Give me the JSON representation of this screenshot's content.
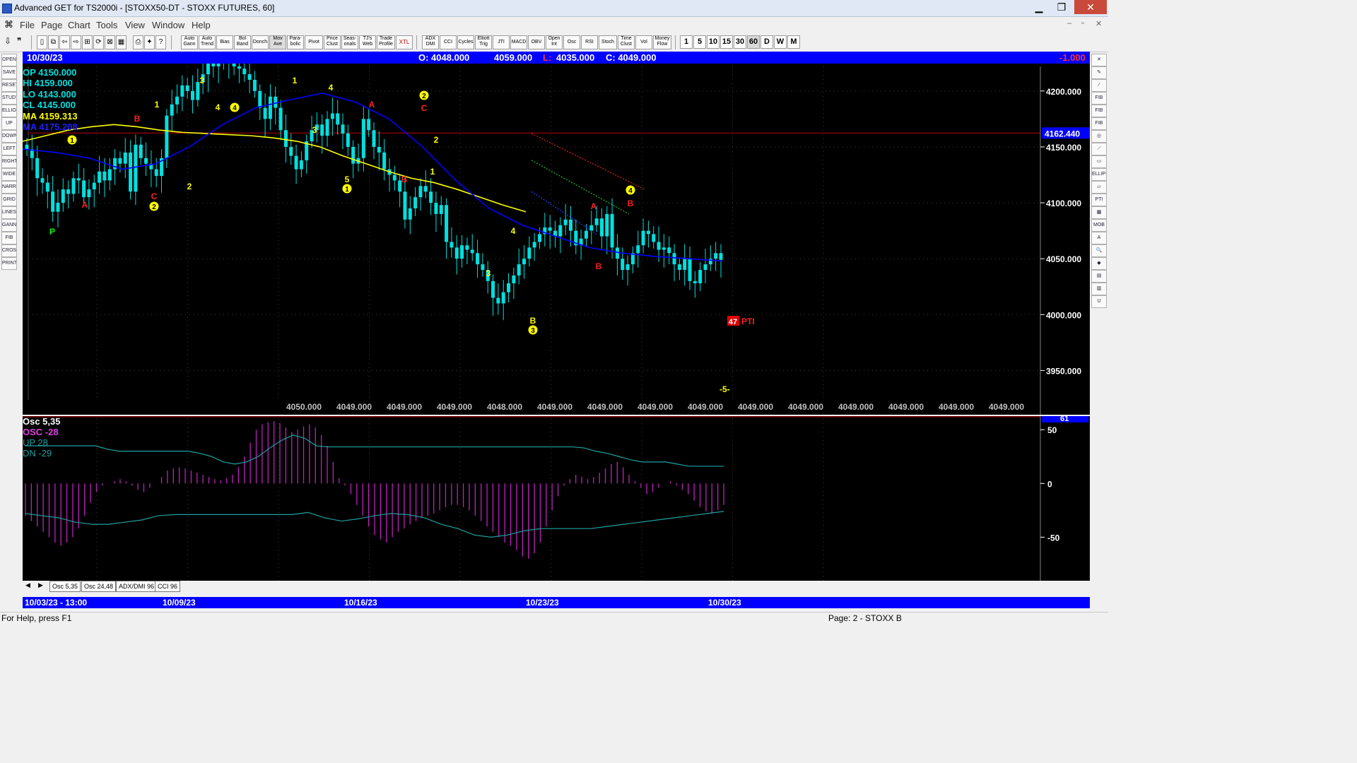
{
  "window": {
    "title": "Advanced GET for TS2000i - [STOXX50-DT - STOXX FUTURES, 60]",
    "controls": [
      "▁",
      "❐",
      "✕"
    ]
  },
  "menu": [
    "File",
    "Page",
    "Chart",
    "Tools",
    "View",
    "Window",
    "Help"
  ],
  "toolbar": {
    "studies": [
      "Auto Gann",
      "Auto Trend",
      "Bias",
      "Bol Band",
      "Donch",
      "Mov Ave",
      "Para- bolic",
      "Pivot",
      "Price Clust",
      "Seas- onals",
      "TJ's Web",
      "Trade Profile",
      "XTL",
      "ADX DMI",
      "CCI",
      "Cycles",
      "Elliott Trig",
      "JTI",
      "MACD",
      "OBV",
      "Open Int",
      "Osc",
      "RSI",
      "Stoch",
      "Time Clust",
      "Vol",
      "Money Flow"
    ],
    "timeframes": [
      "1",
      "5",
      "10",
      "15",
      "30",
      "60",
      "D",
      "W",
      "M"
    ],
    "active_timeframe": "60"
  },
  "infobar": {
    "date": "10/30/23",
    "open": "O: 4048.000",
    "high": "4059.000",
    "low_label": "L:",
    "low": "4035.000",
    "close": "C: 4049.000",
    "change": "-1.000"
  },
  "legend": {
    "op": "OP  4150.000",
    "hi": "HI   4159.000",
    "lo": "LO  4143.000",
    "cl": "CL  4145.000",
    "ma1": "MA  4159.313",
    "ma2": "MA  4175.208"
  },
  "price_axis": {
    "ticks": [
      "4200.000",
      "4150.000",
      "4100.000",
      "4050.000",
      "4000.000",
      "3950.000"
    ],
    "ylim": [
      3925,
      4222
    ],
    "current_price": "4162.440",
    "current_price_value": 4162.44
  },
  "bottom_price_row": [
    "4050.000",
    "4049.000",
    "4049.000",
    "4049.000",
    "4048.000",
    "4049.000",
    "4049.000",
    "4049.000",
    "4049.000",
    "4049.000",
    "4049.000",
    "4049.000",
    "4049.000",
    "4049.000",
    "4049.000"
  ],
  "chart_data": {
    "type": "candlestick",
    "title": "STOXX50-DT - STOXX FUTURES, 60",
    "x_dates": [
      "10/03/23 - 13:00",
      "10/09/23",
      "10/16/23",
      "10/23/23",
      "10/30/23"
    ],
    "ylim": [
      3925,
      4222
    ],
    "close_series": [
      4148,
      4140,
      4122,
      4118,
      4110,
      4092,
      4100,
      4112,
      4108,
      4122,
      4120,
      4105,
      4112,
      4118,
      4128,
      4120,
      4130,
      4140,
      4135,
      4145,
      4110,
      4152,
      4140,
      4135,
      4130,
      4124,
      4140,
      4178,
      4188,
      4195,
      4205,
      4200,
      4192,
      4208,
      4215,
      4225,
      4222,
      4230,
      4228,
      4225,
      4222,
      4220,
      4215,
      4210,
      4200,
      4185,
      4175,
      4195,
      4185,
      4165,
      4150,
      4142,
      4130,
      4138,
      4155,
      4165,
      4170,
      4160,
      4175,
      4180,
      4170,
      4162,
      4150,
      4135,
      4140,
      4175,
      4165,
      4150,
      4145,
      4130,
      4125,
      4120,
      4110,
      4085,
      4095,
      4105,
      4115,
      4110,
      4100,
      4090,
      4098,
      4065,
      4060,
      4050,
      4062,
      4058,
      4055,
      4045,
      4040,
      4030,
      4015,
      4010,
      4020,
      4028,
      4035,
      4045,
      4050,
      4060,
      4065,
      4072,
      4078,
      4075,
      4070,
      4080,
      4085,
      4075,
      4062,
      4068,
      4075,
      4080,
      4086,
      4070,
      4090,
      4060,
      4050,
      4040,
      4045,
      4055,
      4062,
      4075,
      4072,
      4065,
      4058,
      4060,
      4055,
      4045,
      4040,
      4050,
      4030,
      4028,
      4040,
      4045,
      4050,
      4055,
      4049
    ],
    "moving_averages": [
      {
        "color": "#ffff00",
        "values": [
          4155,
          4160,
          4165,
          4168,
          4170,
          4168,
          4165,
          4163,
          4162,
          4161,
          4160,
          4158,
          4155,
          4150,
          4142,
          4135,
          4128,
          4122,
          4118,
          4112,
          4105,
          4098,
          4092
        ]
      },
      {
        "color": "#0000ff",
        "values": [
          4148,
          4145,
          4140,
          4130,
          4135,
          4150,
          4170,
          4185,
          4192,
          4198,
          4190,
          4175,
          4150,
          4120,
          4095,
          4080,
          4070,
          4060,
          4055,
          4052,
          4050,
          4048
        ]
      }
    ],
    "trend_channel_values": {
      "red": [
        4162,
        4112
      ],
      "green": [
        4138,
        4090
      ],
      "blue": [
        4110,
        4072
      ]
    },
    "wave_labels": [
      "1",
      "A",
      "2",
      "C",
      "P",
      "3",
      "4",
      "4",
      "1",
      "4",
      "3",
      "5",
      "1",
      "A",
      "C",
      "2",
      "2",
      "B",
      "1",
      "4",
      "3",
      "B",
      "3",
      "A",
      "B",
      "4",
      "B"
    ],
    "annotations": {
      "pti": "47",
      "pti_label": "PTI",
      "wave_count": "-5-"
    }
  },
  "oscillator": {
    "legend": {
      "title": "Osc 5,35",
      "osc": "OSC -28",
      "up": "UP   28",
      "dn": "DN   -29"
    },
    "ticks": [
      "50",
      "0",
      "-50"
    ],
    "current": "61",
    "ylim": [
      -80,
      60
    ],
    "histogram": [
      -30,
      -35,
      -40,
      -45,
      -50,
      -55,
      -58,
      -55,
      -50,
      -42,
      -30,
      -18,
      -8,
      -2,
      0,
      2,
      4,
      2,
      -2,
      -6,
      -8,
      -4,
      0,
      6,
      12,
      14,
      15,
      14,
      12,
      10,
      8,
      6,
      4,
      3,
      5,
      8,
      15,
      25,
      38,
      50,
      55,
      57,
      58,
      56,
      52,
      48,
      50,
      53,
      55,
      52,
      45,
      35,
      20,
      5,
      -2,
      -10,
      -20,
      -30,
      -40,
      -48,
      -52,
      -55,
      -50,
      -45,
      -42,
      -38,
      -35,
      -32,
      -30,
      -28,
      -25,
      -22,
      -20,
      -20,
      -22,
      -25,
      -30,
      -35,
      -40,
      -45,
      -50,
      -55,
      -58,
      -62,
      -68,
      -70,
      -65,
      -55,
      -40,
      -25,
      -12,
      -2,
      4,
      8,
      6,
      4,
      6,
      10,
      14,
      18,
      20,
      15,
      8,
      2,
      -4,
      -10,
      -8,
      -4,
      0,
      2,
      -2,
      -6,
      -10,
      -16,
      -22,
      -26,
      -28,
      -25,
      -20
    ],
    "up_line": [
      35,
      35,
      35,
      35,
      35,
      35,
      35,
      32,
      30,
      30,
      30,
      30,
      30,
      30,
      30,
      28,
      25,
      20,
      18,
      20,
      25,
      33,
      40,
      45,
      42,
      35,
      34,
      34,
      34,
      34,
      34,
      34,
      34,
      34,
      34,
      34,
      34,
      34,
      34,
      34,
      34,
      34,
      34,
      34,
      34,
      34,
      34,
      34,
      33,
      30,
      28,
      25,
      22,
      20,
      20,
      20,
      18,
      16,
      16,
      16,
      16
    ],
    "dn_line": [
      -28,
      -30,
      -32,
      -36,
      -38,
      -38,
      -36,
      -34,
      -30,
      -29,
      -29,
      -29,
      -29,
      -29,
      -29,
      -29,
      -29,
      -27,
      -32,
      -35,
      -33,
      -30,
      -28,
      -29,
      -32,
      -38,
      -42,
      -48,
      -50,
      -48,
      -44,
      -42,
      -42,
      -42,
      -42,
      -40,
      -38,
      -36,
      -34,
      -32,
      -30,
      -28,
      -26
    ]
  },
  "tabs": [
    "Osc 5,35",
    "Osc 24,48",
    "ADX/DMI 96",
    "CCI 96"
  ],
  "datebar": [
    "10/03/23 - 13:00",
    "10/09/23",
    "10/16/23",
    "10/23/23",
    "10/30/23"
  ],
  "status": {
    "help": "For Help, press F1",
    "page": "Page: 2 - STOXX B"
  },
  "left_tools": [
    "OPEN",
    "SAVE",
    "RESET",
    "STUDY",
    "ELLIOTT",
    "UP",
    "DOWN",
    "LEFT",
    "RIGHT",
    "WIDE",
    "NARROW",
    "GRID",
    "LINES",
    "GANN",
    "FIB",
    "CROSS",
    "PRINT"
  ],
  "right_tools": [
    "✕",
    "✎",
    "⁄",
    "FIB RET",
    "FIB EXT",
    "FIB TIME",
    "◎",
    "⟋",
    "▭",
    "ELLIPSE",
    "▱",
    "PTI",
    "▦",
    "MOB",
    "A",
    "🔍",
    "◆",
    "▤",
    "▥",
    "U"
  ],
  "colors": {
    "background": "#000000",
    "price_bar": "#00e0e0",
    "osc_bar": "#c020c0",
    "infobar": "#0000ff",
    "current_price_line": "#c00000"
  }
}
